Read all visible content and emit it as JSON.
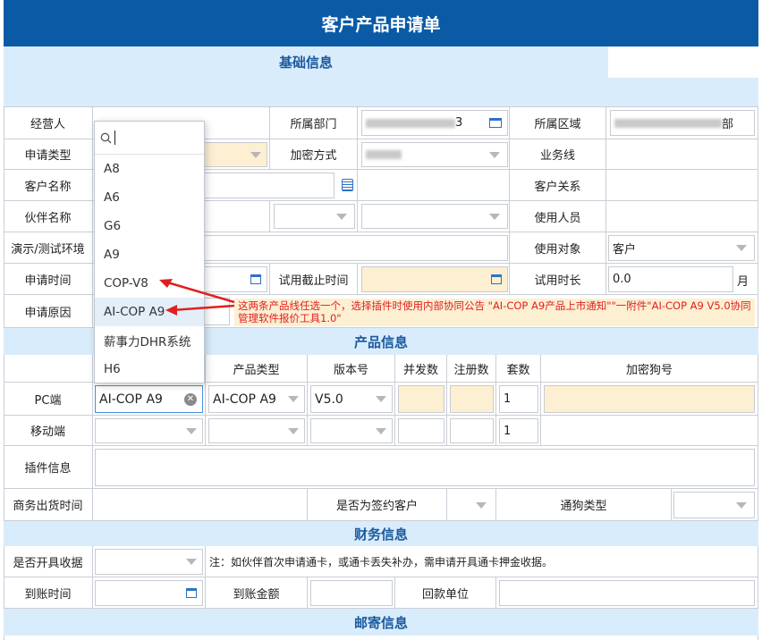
{
  "title": "客户产品申请单",
  "sections": {
    "basic": "基础信息",
    "product": "产品信息",
    "finance": "财务信息",
    "mail": "邮寄信息"
  },
  "basic": {
    "operator_label": "经营人",
    "dept_label": "所属部门",
    "region_label": "所属区域",
    "region_suffix": "部",
    "dept_suffix": "3",
    "apply_type_label": "申请类型",
    "encrypt_label": "加密方式",
    "business_line_label": "业务线",
    "customer_name_label": "客户名称",
    "customer_relation_label": "客户关系",
    "partner_name_label": "伙伴名称",
    "users_label": "使用人员",
    "env_label": "演示/测试环境",
    "target_label": "使用对象",
    "target_value": "客户",
    "apply_time_label": "申请时间",
    "trial_end_label": "试用截止时间",
    "trial_duration_label": "试用时长",
    "trial_duration_value": "0.0",
    "trial_duration_unit": "月",
    "reason_label": "申请原因",
    "note": "这两条产品线任选一个，选择插件时使用内部协同公告 \"AI-COP A9产品上市通知\"\"一附件\"AI-COP A9 V5.0协同管理软件报价工具1.0\""
  },
  "product": {
    "headers": [
      "产品类型",
      "版本号",
      "并发数",
      "注册数",
      "套数",
      "加密狗号"
    ],
    "pc_label": "PC端",
    "pc_product_line": "AI-COP A9",
    "pc_product_type": "AI-COP A9",
    "pc_version": "V5.0",
    "pc_sets": "1",
    "mobile_label": "移动端",
    "mobile_sets": "1",
    "plugin_label": "插件信息",
    "ship_time_label": "商务出货时间",
    "signed_label": "是否为签约客户",
    "dongle_type_label": "通狗类型"
  },
  "finance": {
    "receipt_label": "是否开具收据",
    "receipt_note": "注：如伙伴首次申请通卡，或通卡丢失补办，需申请开具通卡押金收据。",
    "arrival_time_label": "到账时间",
    "amount_label": "到账金额",
    "payer_label": "回款单位"
  },
  "dropdown": {
    "search_value": "",
    "options": [
      "A8",
      "A6",
      "G6",
      "A9",
      "COP-V8",
      "AI-COP A9",
      "薪事力DHR系统",
      "H6"
    ],
    "selected": "AI-COP A9"
  },
  "colors": {
    "header_blue": "#0a5aa6",
    "section_bg": "#d9ecfb",
    "highlight_yellow": "#fdefd2",
    "annotation_red": "#e02020"
  }
}
